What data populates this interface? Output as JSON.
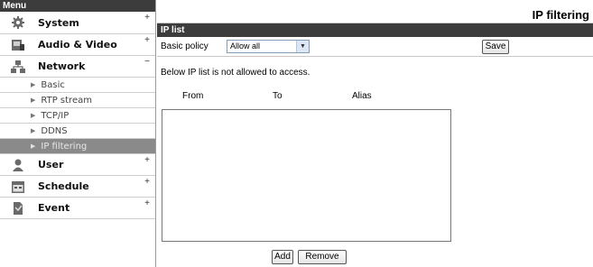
{
  "sidebar": {
    "title": "Menu",
    "items": [
      {
        "label": "System",
        "toggle": "+"
      },
      {
        "label": "Audio & Video",
        "toggle": "+"
      },
      {
        "label": "Network",
        "toggle": "−"
      }
    ],
    "network_sub": [
      {
        "label": "Basic"
      },
      {
        "label": "RTP stream"
      },
      {
        "label": "TCP/IP"
      },
      {
        "label": "DDNS"
      },
      {
        "label": "IP filtering"
      }
    ],
    "items_after": [
      {
        "label": "User",
        "toggle": "+"
      },
      {
        "label": "Schedule",
        "toggle": "+"
      },
      {
        "label": "Event",
        "toggle": "+"
      }
    ],
    "arrow": "▶"
  },
  "main": {
    "page_title": "IP filtering",
    "section_title": "IP list",
    "policy_label": "Basic policy",
    "policy_value": "Allow all",
    "save_label": "Save",
    "note": "Below IP list is not allowed to access.",
    "columns": {
      "from": "From",
      "to": "To",
      "alias": "Alias"
    },
    "add_label": "Add",
    "remove_label": "Remove"
  }
}
